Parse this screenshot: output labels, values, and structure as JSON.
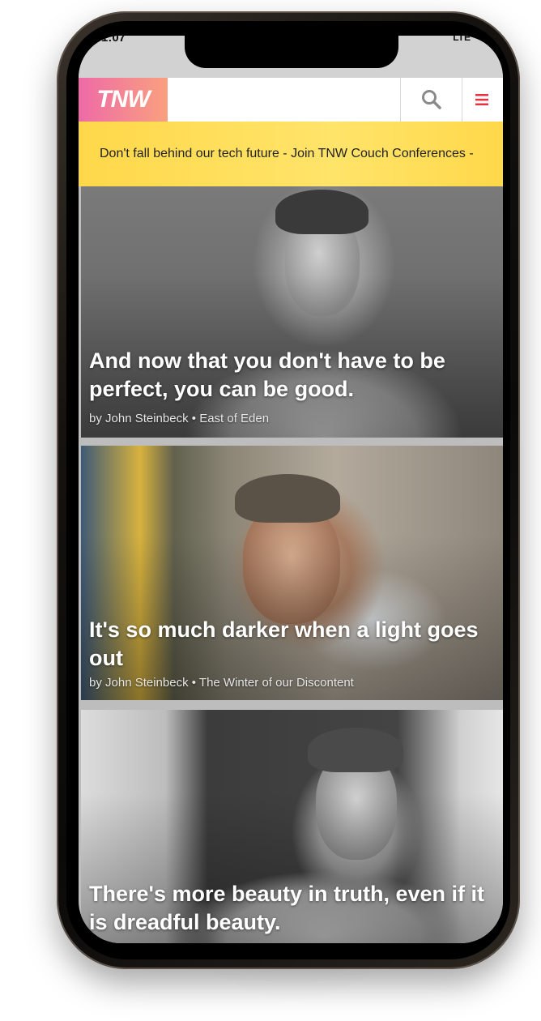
{
  "status_bar": {
    "time": "1:07",
    "signal": "LTE"
  },
  "header": {
    "logo_text": "TNW"
  },
  "banner": {
    "text": "Don't fall behind our tech future - Join TNW Couch Conferences -"
  },
  "quotes": [
    {
      "text": "And now that you don't have to be perfect, you can be good.",
      "author": "by John Steinbeck",
      "separator": "•",
      "source": "East of Eden"
    },
    {
      "text": "It's so much darker when a light goes out",
      "author": "by John Steinbeck",
      "separator": "•",
      "source": "The Winter of our Discontent"
    },
    {
      "text": "There's more beauty in truth, even if it is dreadful beauty.",
      "author": "",
      "separator": "",
      "source": ""
    }
  ],
  "icons": {
    "search": "search-icon",
    "menu": "hamburger-menu-icon"
  },
  "colors": {
    "banner": "#ffde55",
    "logo_gradient_start": "#ee6aa7",
    "logo_gradient_end": "#f9a07f",
    "menu_icon": "#e5323e"
  }
}
